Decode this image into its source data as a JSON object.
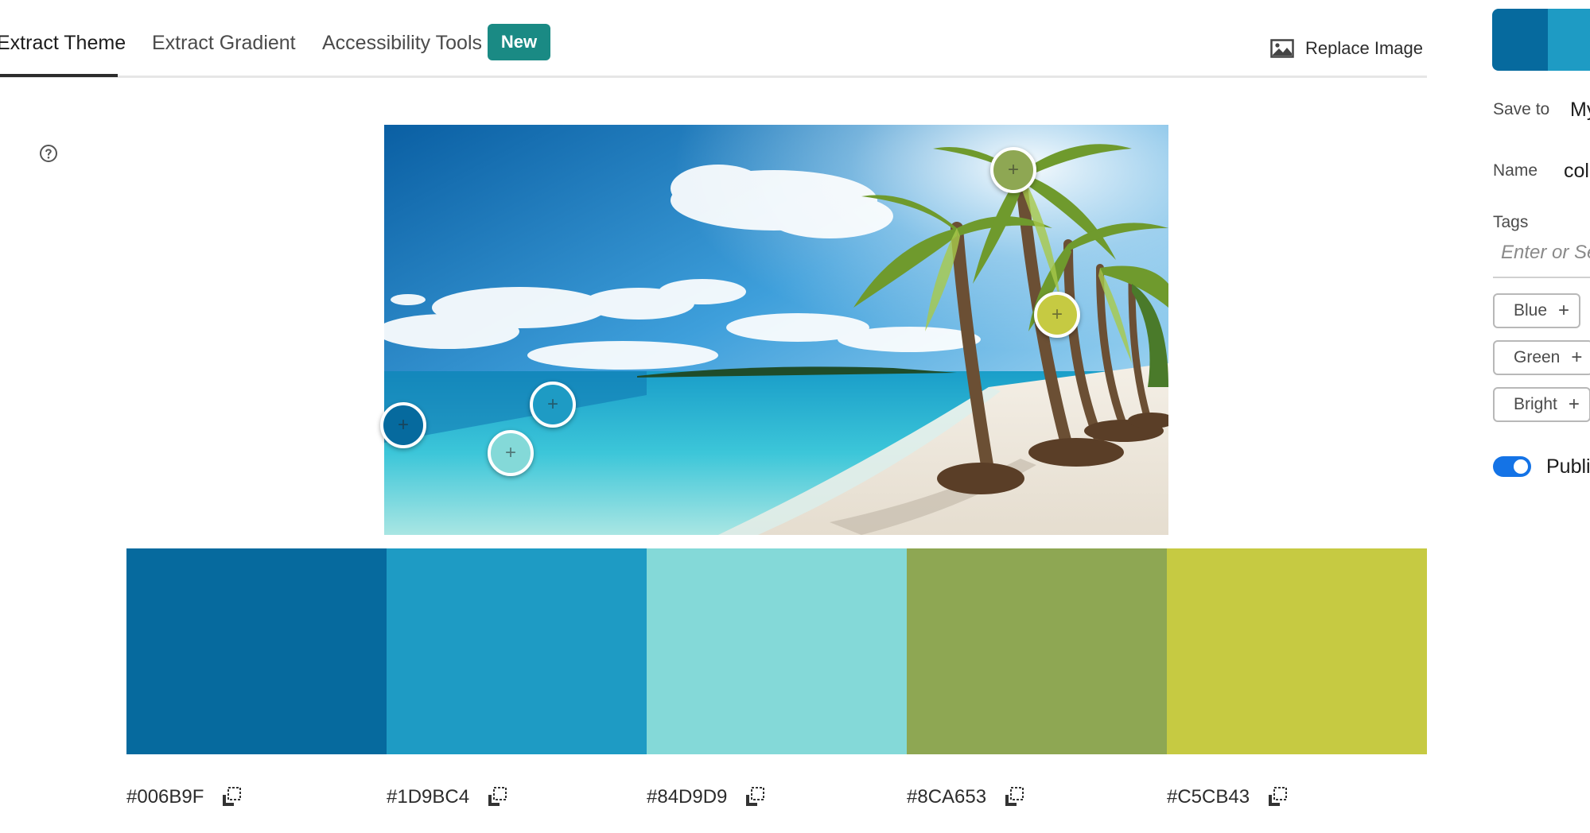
{
  "tabs": [
    {
      "label": "Extract Theme",
      "active": true
    },
    {
      "label": "Extract Gradient",
      "active": false
    },
    {
      "label": "Accessibility Tools",
      "active": false
    }
  ],
  "new_badge": "New",
  "replace_image": {
    "label": "Replace Image",
    "icon": "image-icon"
  },
  "help_icon": "question-circle-icon",
  "palette": [
    {
      "hex": "#006B9F",
      "color": "#066a9e"
    },
    {
      "hex": "#1D9BC4",
      "color": "#1e9bc4"
    },
    {
      "hex": "#84D9D9",
      "color": "#84d9d8"
    },
    {
      "hex": "#8CA653",
      "color": "#8ea753"
    },
    {
      "hex": "#C5CB43",
      "color": "#c6ca42"
    }
  ],
  "copy_icon": "copy-icon",
  "right_panel": {
    "save_to": {
      "label": "Save to",
      "value": "My"
    },
    "name": {
      "label": "Name",
      "value": "col"
    },
    "tags": {
      "label": "Tags",
      "placeholder": "Enter or Sel"
    },
    "suggested_tags": [
      "Blue",
      "Green",
      "Bright"
    ],
    "publish": {
      "label": "Publis",
      "on": true
    }
  }
}
